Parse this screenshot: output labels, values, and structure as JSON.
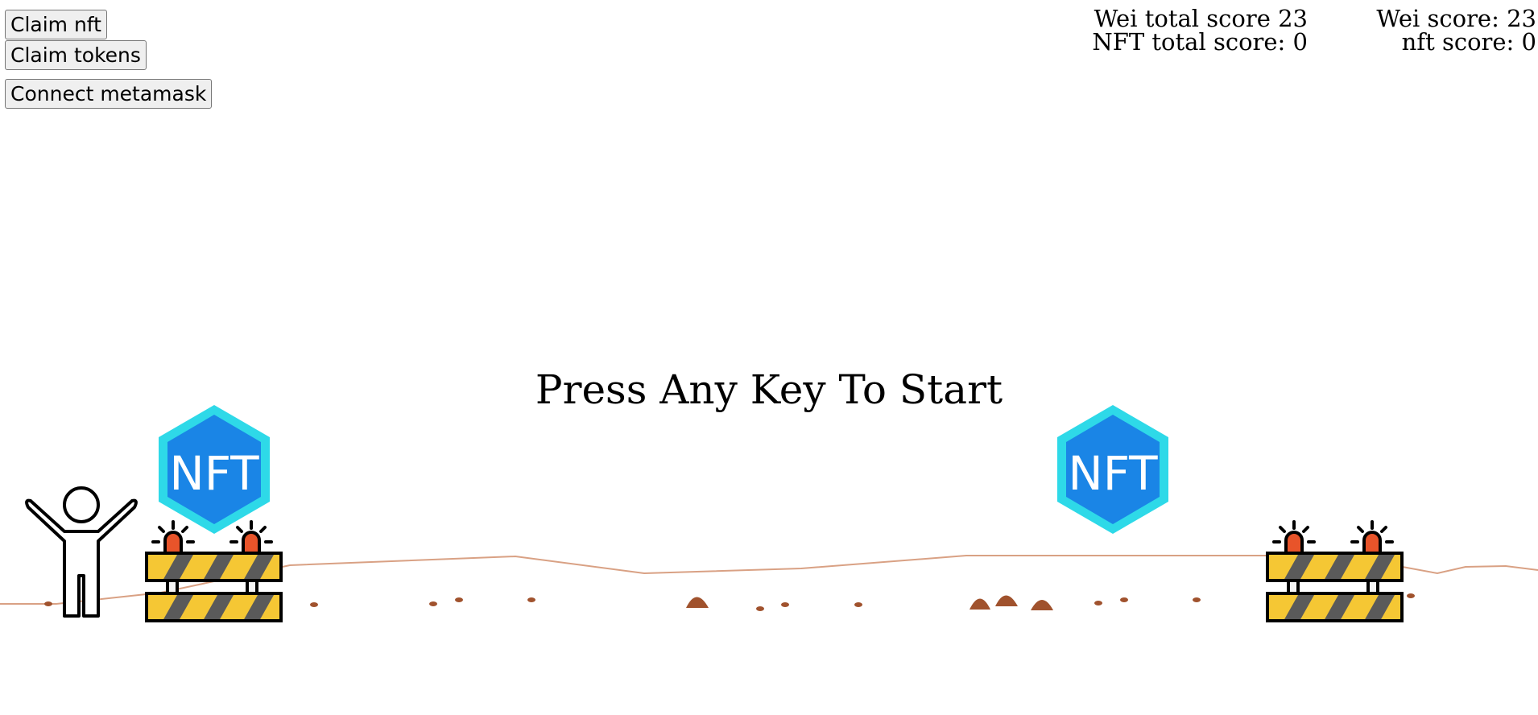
{
  "buttons": {
    "claim_nft": "Claim nft",
    "claim_tokens": "Claim tokens",
    "connect_metamask": "Connect metamask"
  },
  "scores": {
    "wei_total": "Wei total score 23",
    "nft_total": "NFT total score: 0",
    "wei": "Wei score: 23",
    "nft": "nft score: 0"
  },
  "game": {
    "start_prompt": "Press Any Key To Start",
    "nft_badge_text": "NFT"
  },
  "icons": {
    "player": "person-arms-up-icon",
    "obstacle": "road-barrier-icon",
    "collectible": "nft-badge-icon"
  },
  "colors": {
    "ground_line": "#d9a184",
    "pebble": "#a0522d",
    "nft_outer": "#2ed9e8",
    "nft_inner": "#1a85e6",
    "barrier_yellow": "#f5c734",
    "barrier_stripe": "#5a5a5a",
    "siren": "#e8542a"
  }
}
